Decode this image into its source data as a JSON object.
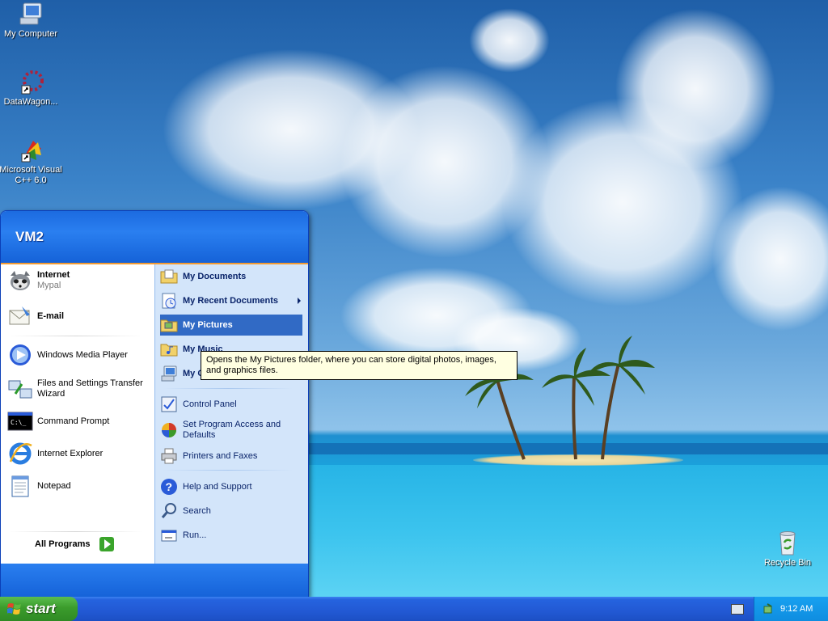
{
  "desktop": {
    "icons": [
      {
        "label": "My Computer"
      },
      {
        "label": "DataWagon..."
      },
      {
        "label": "Microsoft Visual C++ 6.0"
      },
      {
        "label": "Recycle Bin"
      }
    ]
  },
  "start_menu": {
    "user": "VM2",
    "pinned": [
      {
        "title": "Internet",
        "subtitle": "Mypal"
      },
      {
        "title": "E-mail"
      }
    ],
    "recent": [
      {
        "label": "Windows Media Player"
      },
      {
        "label": "Files and Settings Transfer Wizard"
      },
      {
        "label": "Command Prompt"
      },
      {
        "label": "Internet Explorer"
      },
      {
        "label": "Notepad"
      }
    ],
    "all_programs": "All Programs",
    "right": [
      {
        "label": "My Documents"
      },
      {
        "label": "My Recent Documents"
      },
      {
        "label": "My Pictures"
      },
      {
        "label": "My Music"
      },
      {
        "label": "My Computer"
      },
      {
        "label": "Control Panel"
      },
      {
        "label": "Set Program Access and Defaults"
      },
      {
        "label": "Printers and Faxes"
      },
      {
        "label": "Help and Support"
      },
      {
        "label": "Search"
      },
      {
        "label": "Run..."
      }
    ]
  },
  "tooltip": "Opens the My Pictures folder, where you can store digital photos, images, and graphics files.",
  "taskbar": {
    "start_label": "start",
    "clock": "9:12 AM"
  },
  "colors": {
    "taskbar_blue": "#2259d4",
    "start_green": "#3b9c2c",
    "selection": "#316ac5",
    "tooltip_bg": "#ffffe1"
  }
}
